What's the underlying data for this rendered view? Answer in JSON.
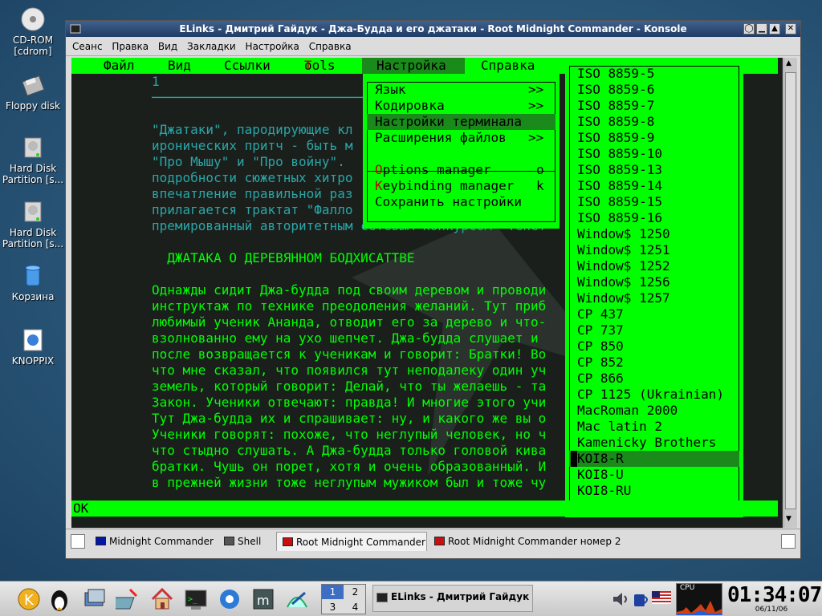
{
  "desktop": {
    "icons": [
      {
        "label": "CD-ROM\n[cdrom]"
      },
      {
        "label": "Floppy disk"
      },
      {
        "label": "Hard Disk Partition [s..."
      },
      {
        "label": "Hard Disk Partition [s..."
      },
      {
        "label": "Корзина"
      },
      {
        "label": "KNOPPIX"
      }
    ]
  },
  "window": {
    "title": "ELinks - Дмитрий Гайдук - Джа-Будда и его джатаки - Root Midnight Commander - Konsole",
    "menu": [
      "Сеанс",
      "Правка",
      "Вид",
      "Закладки",
      "Настройка",
      "Справка"
    ]
  },
  "elinks": {
    "menubar": [
      "Файл",
      "Вид",
      "Ссылки",
      "Tools",
      "Настройка",
      "Справка"
    ],
    "content_lines": [
      "1",
      "────────────────────────────────────────────",
      "",
      "\"Джатаки\", пародирующие кл",
      "иронических притч - быть м",
      "\"Про Мышу\" и \"Про войну\".",
      "подробности сюжетных хитро",
      "впечатление правильной раз",
      "прилагается трактат \"Фалло",
      "премированный авторитетным сетевым конкурсом \"Тенет",
      "",
      "  ДЖАТАКА О ДЕРЕВЯННОМ БОДХИСАТТВЕ",
      "",
      "Однажды сидит Джа-будда под своим деревом и проводи",
      "инструктаж по технике преодоления желаний. Тут приб",
      "любимый ученик Ананда, отводит его за дерево и что-",
      "взолнованно ему на ухо шепчет. Джа-будда слушает и",
      "после возвращается к ученикам и говорит: Братки! Во",
      "что мне сказал, что появился тут неподалеку один уч",
      "земель, который говорит: Делай, что ты желаешь - та",
      "Закон. Ученики отвечают: правда! И многие этого учи",
      "Тут Джа-будда их и спрашивает: ну, и какого же вы о",
      "Ученики говорят: похоже, что неглупый человек, но ч",
      "что стыдно слушать. А Джа-будда только головой кива",
      "братки. Чушь он порет, хотя и очень образованный. И",
      "в прежней жизни тоже неглупым мужиком был и тоже чу"
    ],
    "settings_menu": [
      {
        "label": "Язык",
        "hotkey_char": "",
        "rest": "",
        "suffix": ">>"
      },
      {
        "label": "Кодировка",
        "hotkey_char": "",
        "rest": "",
        "suffix": ">>"
      },
      {
        "label": "Настройки терминала",
        "hotkey_char": "",
        "rest": "",
        "suffix": ""
      },
      {
        "label": "Расширения файлов",
        "hotkey_char": "",
        "rest": "",
        "suffix": ">>"
      },
      {
        "label": "",
        "hotkey_char": "O",
        "rest": "ptions manager",
        "suffix": "o"
      },
      {
        "label": "",
        "hotkey_char": "K",
        "rest": "eybinding manager",
        "suffix": "k"
      },
      {
        "label": "Сохранить настройки",
        "hotkey_char": "",
        "rest": "",
        "suffix": ""
      }
    ],
    "encoding_menu": [
      "ISO 8859-5",
      "ISO 8859-6",
      "ISO 8859-7",
      "ISO 8859-8",
      "ISO 8859-9",
      "ISO 8859-10",
      "ISO 8859-13",
      "ISO 8859-14",
      "ISO 8859-15",
      "ISO 8859-16",
      "Window$ 1250",
      "Window$ 1251",
      "Window$ 1252",
      "Window$ 1256",
      "Window$ 1257",
      "CP 437",
      "CP 737",
      "CP 850",
      "CP 852",
      "CP 866",
      "CP 1125 (Ukrainian)",
      "MacRoman 2000",
      "Mac latin 2",
      "Kamenicky Brothers",
      "KOI8-R",
      "KOI8-U",
      "KOI8-RU"
    ],
    "encoding_selected": "KOI8-R",
    "status": "OK"
  },
  "tabs": [
    "Midnight Commander",
    "Shell",
    "Root Midnight Commander",
    "Root Midnight Commander номер 2"
  ],
  "active_tab": "Root Midnight Commander",
  "panel": {
    "pager": [
      "1",
      "2",
      "3",
      "4"
    ],
    "task_title": "ELinks - Дмитрий Гайдук - Д",
    "cpu_label": "CPU",
    "clock": "01:34:07",
    "date": "06/11/06"
  },
  "colors": {
    "term_fg": "#00ff00",
    "term_bg": "#1a1f1c",
    "menu_bg": "#00ff00",
    "menu_sel": "#1a8a1a",
    "hotkey": "#c00000",
    "titlebar": "#2a4a78"
  }
}
